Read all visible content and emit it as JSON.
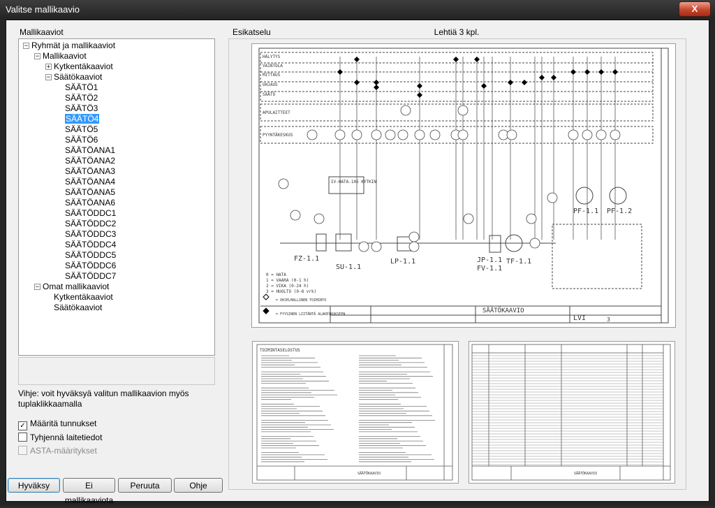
{
  "window": {
    "title": "Valitse mallikaavio",
    "close_label": "X"
  },
  "tree_group_label": "Mallikaaviot",
  "tree": [
    {
      "label": "Ryhmät ja mallikaaviot",
      "expander": "−"
    },
    {
      "label": "Mallikaaviot",
      "expander": "−"
    },
    {
      "label": "Kytkentäkaaviot",
      "expander": "+"
    },
    {
      "label": "Säätökaaviot",
      "expander": "−"
    },
    {
      "label": "SÄÄTÖ1"
    },
    {
      "label": "SÄÄTÖ2"
    },
    {
      "label": "SÄÄTÖ3"
    },
    {
      "label": "SÄÄTÖ4",
      "selected": true
    },
    {
      "label": "SÄÄTÖ5"
    },
    {
      "label": "SÄÄTÖ6"
    },
    {
      "label": "SÄÄTÖANA1"
    },
    {
      "label": "SÄÄTÖANA2"
    },
    {
      "label": "SÄÄTÖANA3"
    },
    {
      "label": "SÄÄTÖANA4"
    },
    {
      "label": "SÄÄTÖANA5"
    },
    {
      "label": "SÄÄTÖANA6"
    },
    {
      "label": "SÄÄTÖDDC1"
    },
    {
      "label": "SÄÄTÖDDC2"
    },
    {
      "label": "SÄÄTÖDDC3"
    },
    {
      "label": "SÄÄTÖDDC4"
    },
    {
      "label": "SÄÄTÖDDC5"
    },
    {
      "label": "SÄÄTÖDDC6"
    },
    {
      "label": "SÄÄTÖDDC7"
    },
    {
      "label": "Omat mallikaaviot",
      "expander": "−"
    },
    {
      "label": "Kytkentäkaaviot"
    },
    {
      "label": "Säätökaaviot"
    }
  ],
  "hint": "Vihje: voit hyväksyä valitun mallikaavion myös tuplaklikkaamalla",
  "checkboxes": [
    {
      "label": "Määritä tunnukset",
      "checked": true
    },
    {
      "label": "Tyhjennä laitetiedot",
      "checked": false
    },
    {
      "label": "ASTA-määritykset",
      "checked": false,
      "disabled": true
    }
  ],
  "buttons": {
    "ok": "Hyväksy",
    "none": "Ei mallikaaviota",
    "cancel": "Peruuta",
    "help": "Ohje"
  },
  "preview": {
    "group_label": "Esikatselu",
    "page_count": "Lehtiä 3 kpl.",
    "sheet1": {
      "rows": [
        "HÄLYTYS",
        "VAINTOLA",
        "MITTAUS",
        "OHJAUS",
        "SÄÄTÖ",
        "APULAITTEET",
        "PYYNTÄKESKUS"
      ],
      "box_text": "IV-HATA-105 KYTKIN",
      "units": [
        "FZ-1.1",
        "SU-1.1",
        "LP-1.1",
        "JP-1.1",
        "TF-1.1",
        "FV-1.1",
        "PF-1.1",
        "PF-1.2"
      ],
      "legend": [
        "0 = HATA",
        "1 = VAARA (0-1 h)",
        "2 = VIKA (0-24 h)",
        "3 = HUOLTO (0-8 vrk)"
      ],
      "legend2": [
        "= OHJELMALLINEN TOIMINTO",
        "= FYYSINEN LIITÄNTÄ ALAKESKUKSEEN"
      ],
      "title_block": "SÄÄTÖKAAVIO",
      "discipline": "LVI",
      "sheet_no": "3"
    },
    "sheet2": {
      "title": "TOIMINTASELOSTUS",
      "footer": "SÄÄTÖKAAVIO"
    },
    "sheet3": {
      "footer": "SÄÄTÖKAAVIO"
    }
  }
}
